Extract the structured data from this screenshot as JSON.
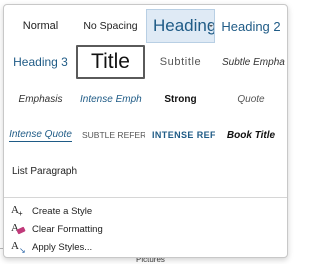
{
  "document": {
    "bottom_label": "Pictures"
  },
  "styles_gallery": {
    "rows": [
      [
        {
          "label": "Normal"
        },
        {
          "label": "No Spacing"
        },
        {
          "label": "Heading"
        },
        {
          "label": "Heading 2"
        }
      ],
      [
        {
          "label": "Heading 3"
        },
        {
          "label": "Title"
        },
        {
          "label": "Subtitle"
        },
        {
          "label": "Subtle Empha"
        }
      ],
      [
        {
          "label": "Emphasis"
        },
        {
          "label": "Intense Emph"
        },
        {
          "label": "Strong"
        },
        {
          "label": "Quote"
        }
      ],
      [
        {
          "label": "Intense Quote"
        },
        {
          "label": "Subtle Referen"
        },
        {
          "label": "Intense Refer"
        },
        {
          "label": "Book Title"
        }
      ],
      [
        {
          "label": "List Paragraph"
        }
      ]
    ],
    "selected_style": "Title",
    "hovered_style": "Heading",
    "accent_color": "#1f5b86"
  },
  "menu": {
    "create_style": "Create a Style",
    "clear_formatting": "Clear Formatting",
    "apply_styles": "Apply Styles..."
  }
}
